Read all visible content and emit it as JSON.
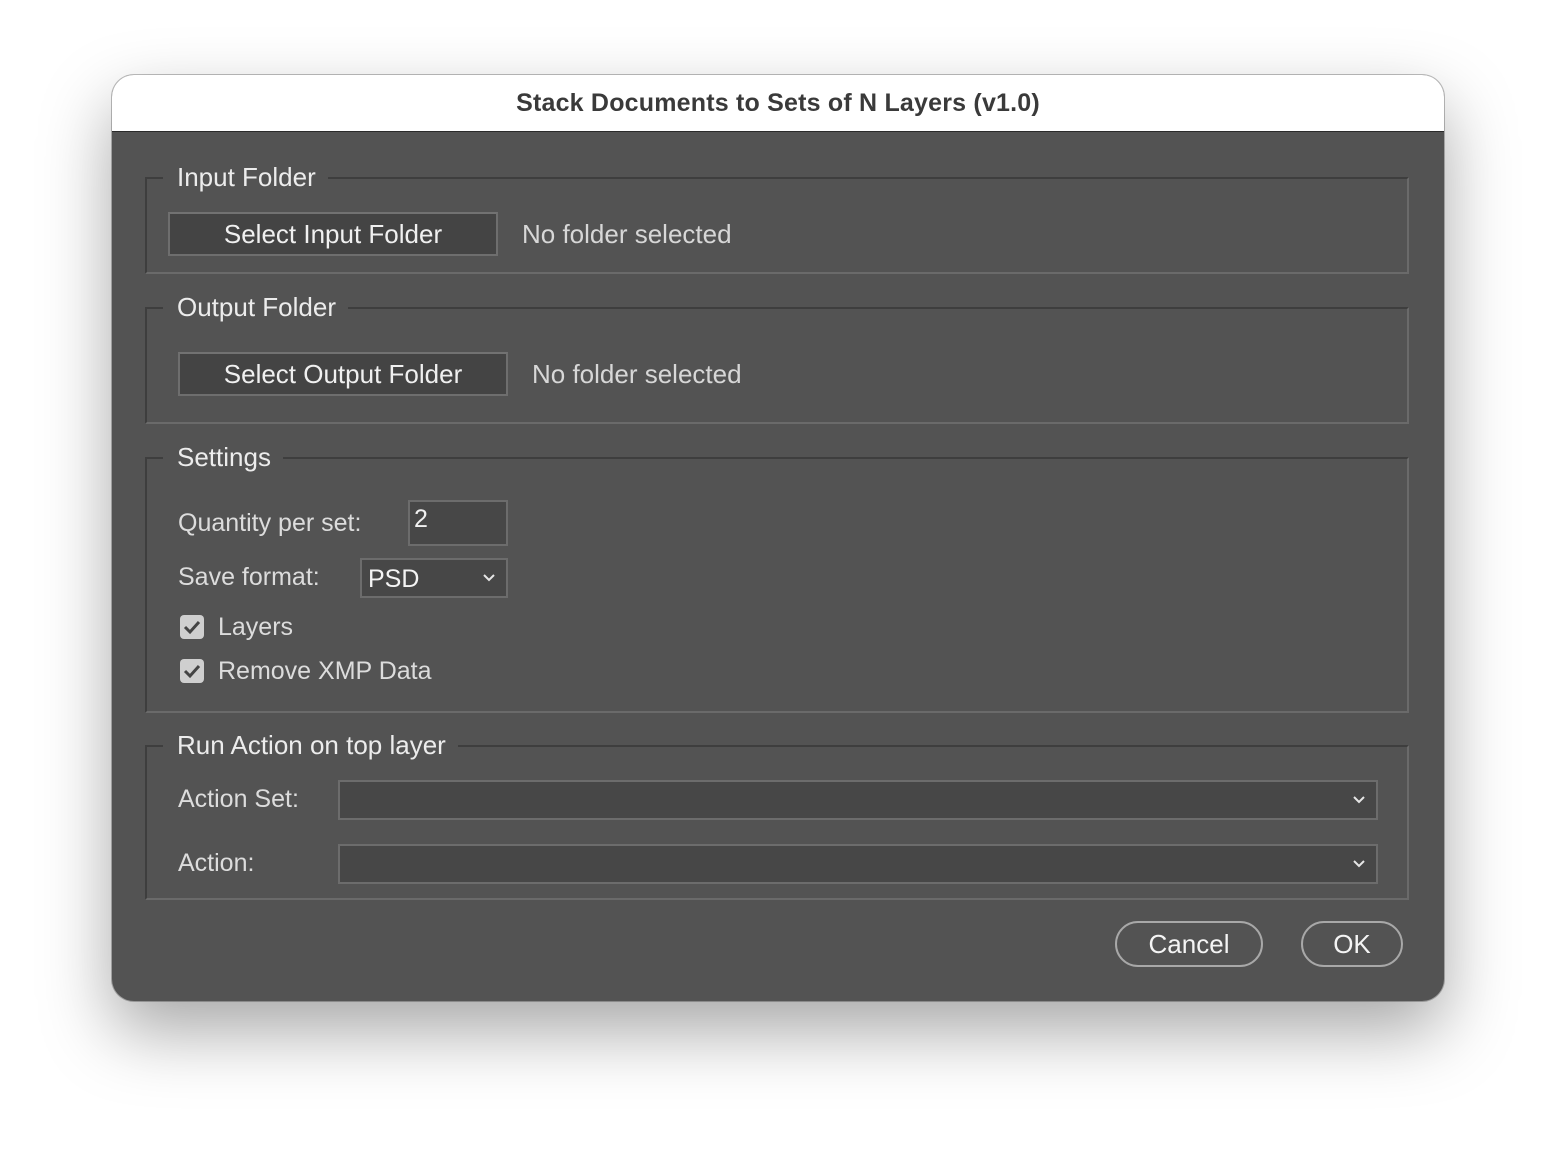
{
  "window": {
    "title": "Stack Documents to Sets of N Layers (v1.0)"
  },
  "input_folder": {
    "section_title": "Input Folder",
    "button_label": "Select Input Folder",
    "status": "No folder selected"
  },
  "output_folder": {
    "section_title": "Output Folder",
    "button_label": "Select Output Folder",
    "status": "No folder selected"
  },
  "settings": {
    "section_title": "Settings",
    "quantity_label": "Quantity per set:",
    "quantity_value": "2",
    "save_format_label": "Save format:",
    "save_format_value": "PSD",
    "layers_label": "Layers",
    "layers_checked": true,
    "remove_xmp_label": "Remove XMP Data",
    "remove_xmp_checked": true
  },
  "run_action": {
    "section_title": "Run Action on top layer",
    "action_set_label": "Action Set:",
    "action_set_value": "",
    "action_label": "Action:",
    "action_value": ""
  },
  "footer": {
    "cancel_label": "Cancel",
    "ok_label": "OK"
  },
  "icons": {
    "dropdown": "chevron-down-icon",
    "check": "checkmark-icon"
  },
  "colors": {
    "dialog_background": "#535353",
    "titlebar_background": "#ffffff",
    "text": "#ececec"
  }
}
